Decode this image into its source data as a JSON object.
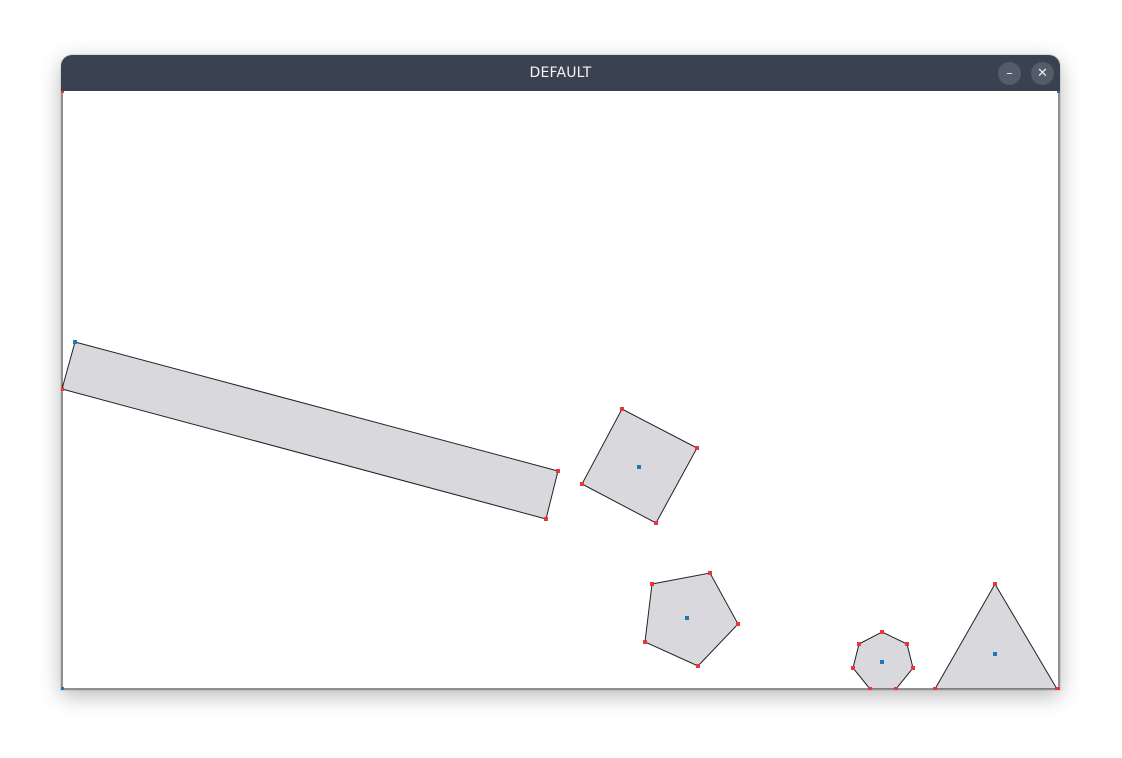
{
  "window": {
    "title": "DEFAULT",
    "minimize_label": "–",
    "close_label": "✕"
  },
  "colors": {
    "titlebar": "#3a4150",
    "shape_fill": "#d9d8dd",
    "shape_stroke": "#222222",
    "vertex": "#e8363c",
    "center": "#1f78b4"
  },
  "scene": {
    "shapes": [
      {
        "name": "rectangle",
        "kind": "rectangle"
      },
      {
        "name": "square",
        "kind": "square"
      },
      {
        "name": "pentagon",
        "kind": "pentagon"
      },
      {
        "name": "heptagon",
        "kind": "heptagon"
      },
      {
        "name": "triangle",
        "kind": "triangle"
      }
    ]
  }
}
